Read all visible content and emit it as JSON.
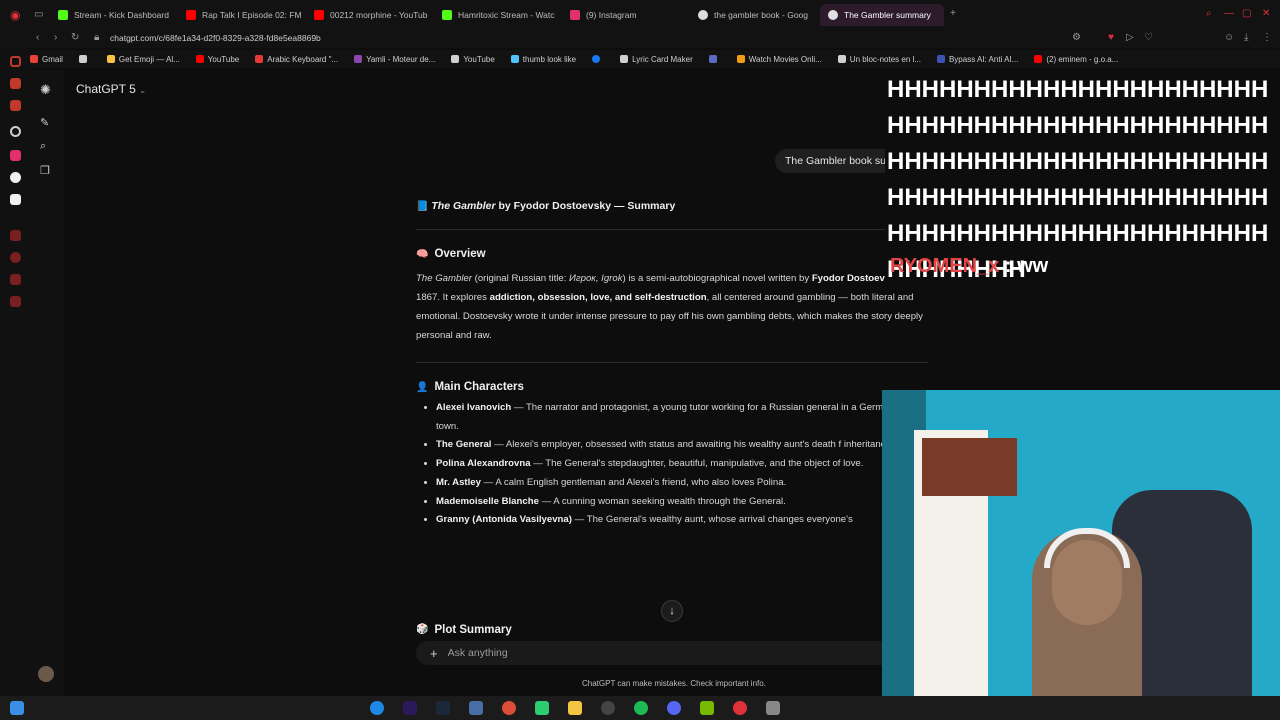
{
  "browser": {
    "tabs": [
      {
        "label": "Stream - Kick Dashboard",
        "color": "#53fc18"
      },
      {
        "label": "Rap Talk I Episode 02: FM",
        "color": "#ff0000"
      },
      {
        "label": "00212 morphine - YouTub",
        "color": "#ff0000"
      },
      {
        "label": "Hamritoxic Stream - Watc",
        "color": "#53fc18"
      },
      {
        "label": "(9) Instagram",
        "color": "#e1306c"
      },
      {
        "label": "the gambler book - Goog",
        "color": "#dddddd"
      },
      {
        "label": "The Gambler summary",
        "color": "#e0e0e0",
        "active": true
      }
    ],
    "url": "chatgpt.com/c/68fe1a34-d2f0-8329-a328-fd8e5ea8869b",
    "bookmarks": [
      {
        "label": "Gmail",
        "color": "#ea4335"
      },
      {
        "label": "",
        "color": "#cfcfcf"
      },
      {
        "label": "Get Emoji — Al...",
        "color": "#f6c343"
      },
      {
        "label": "YouTube",
        "color": "#ff0000"
      },
      {
        "label": "Arabic Keyboard \"...",
        "color": "#e53935"
      },
      {
        "label": "Yamli - Moteur de...",
        "color": "#8e44ad"
      },
      {
        "label": "YouTube",
        "color": "#cfcfcf"
      },
      {
        "label": "thumb look like",
        "color": "#4fc3f7"
      },
      {
        "label": "",
        "color": "#1877f2"
      },
      {
        "label": "Lyric Card Maker",
        "color": "#cfcfcf"
      },
      {
        "label": "",
        "color": "#5c6bc0"
      },
      {
        "label": "Watch Movies Onli...",
        "color": "#f39c12"
      },
      {
        "label": "Un bloc-notes en l...",
        "color": "#cfcfcf"
      },
      {
        "label": "Bypass AI: Anti AI...",
        "color": "#3f51b5"
      },
      {
        "label": "(2) eminem - g.o.a...",
        "color": "#ff0000"
      }
    ]
  },
  "chatgpt": {
    "model_label": "ChatGPT 5",
    "user_message": "The Gambler book summary",
    "title_emoji": "📘",
    "title_italic": "The Gambler",
    "title_rest": " by Fyodor Dostoevsky — Summary",
    "overview": {
      "emoji": "🧠",
      "heading": "Overview",
      "t1": "The Gambler",
      "t2": " (original Russian title: ",
      "t3": "Игрок, Igrok",
      "t4": ") is a semi-autobiographical novel written by ",
      "t5": "Fyodor Dostoevsky",
      "t6": " in 1867. It explores ",
      "t7": "addiction, obsession, love, and self-destruction",
      "t8": ", all centered around gambling — both literal and emotional. Dostoevsky wrote it under intense pressure to pay off his own gambling debts, which makes the story deeply personal and raw."
    },
    "characters": {
      "emoji": "👤",
      "heading": "Main Characters",
      "items": [
        {
          "name": "Alexei Ivanovich",
          "desc": " — The narrator and protagonist, a young tutor working for a Russian general in a German resort town."
        },
        {
          "name": "The General",
          "desc": " — Alexei's employer, obsessed with status and awaiting his wealthy aunt's death f inheritance."
        },
        {
          "name": "Polina Alexandrovna",
          "desc": " — The General's stepdaughter, beautiful, manipulative, and the object of love."
        },
        {
          "name": "Mr. Astley",
          "desc": " — A calm English gentleman and Alexei's friend, who also loves Polina."
        },
        {
          "name": "Mademoiselle Blanche",
          "desc": " — A cunning woman seeking wealth through the General."
        },
        {
          "name": "Granny (Antonida Vasilyevna)",
          "desc": " — The General's wealthy aunt, whose arrival changes everyone's"
        }
      ]
    },
    "plot": {
      "emoji": "🎲",
      "heading": "Plot Summary"
    },
    "composer_placeholder": "Ask anything",
    "disclaimer": "ChatGPT can make mistakes. Check important info."
  },
  "stream_overlay": {
    "spam_text": "HHHHHHHHHHHHHHHHHHHHHHHHHHHHHHHHHHHHHHHHHHHHHHHHHHHHHHHHHHHHHHHHHHHHHHHHHHHHHHHHHHHHHHHHHHHHHHHHHHHHHHHHHHHHHHHHHHHHHH",
    "chat_user": "RYOMEN_x",
    "chat_sep": " : ",
    "chat_msg": "ww"
  }
}
